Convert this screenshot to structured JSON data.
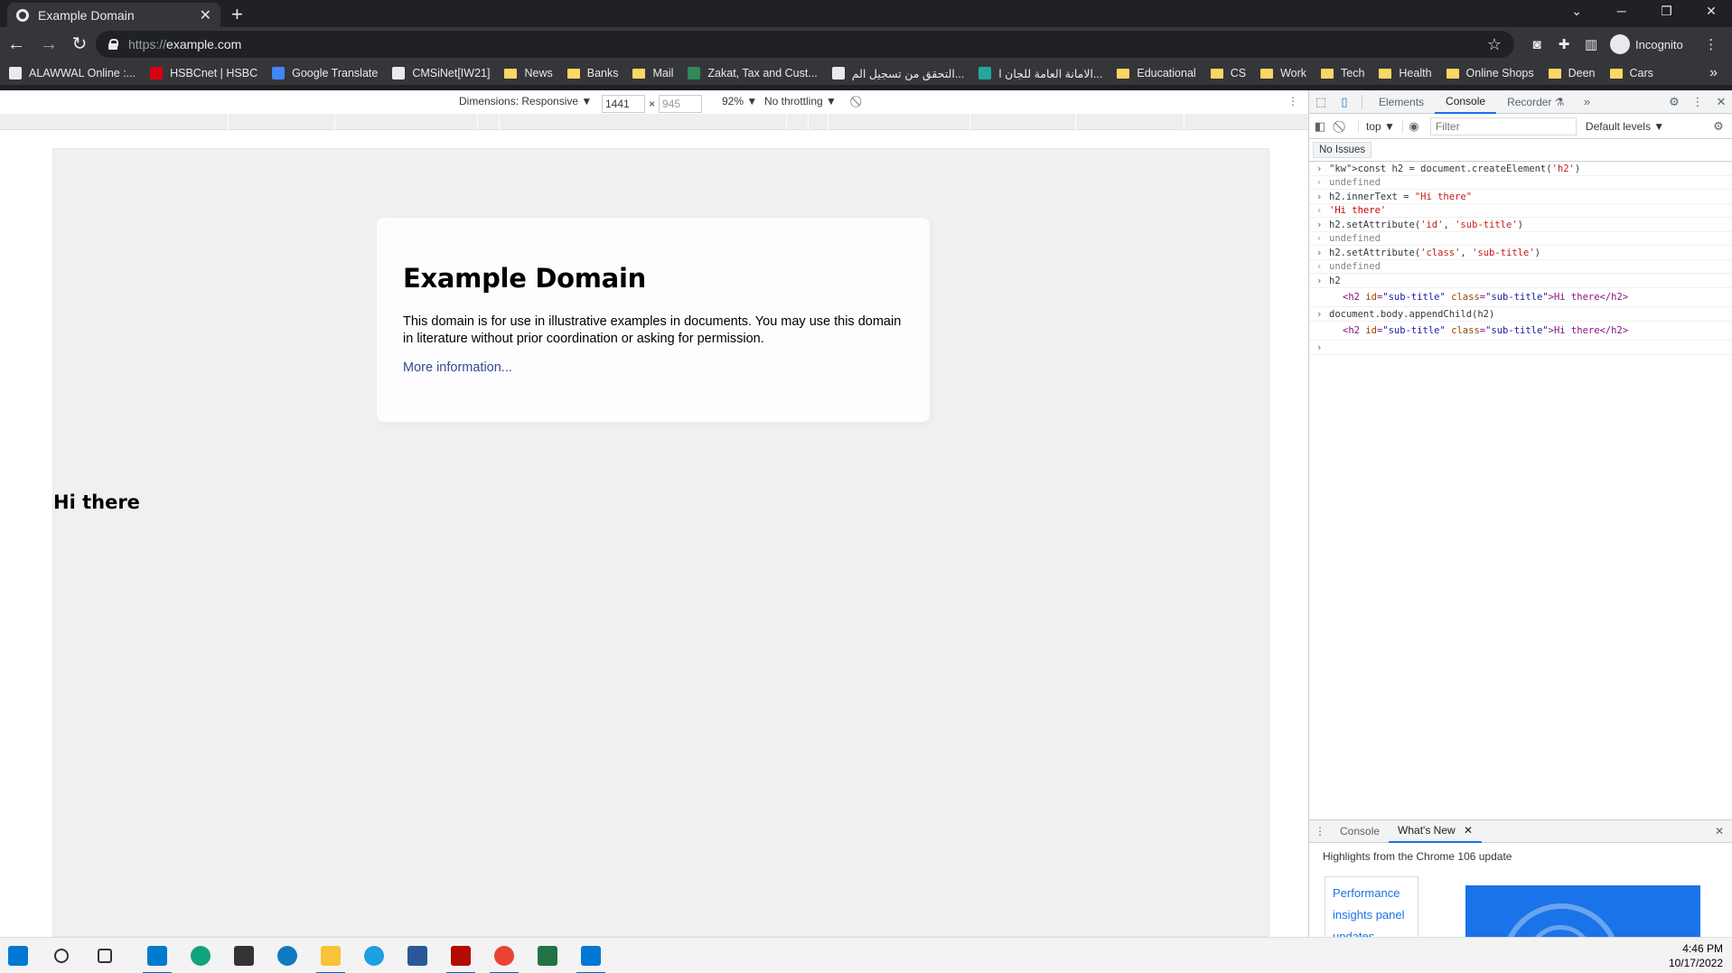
{
  "browser": {
    "tab_title": "Example Domain",
    "tab_close": "✕",
    "new_tab": "+",
    "url_scheme": "https://",
    "url_host": "example.com",
    "profile_label": "Incognito",
    "window_controls": {
      "minimize": "─",
      "restore": "❐",
      "close": "✕",
      "tab_search": "⌄"
    }
  },
  "bookmarks": [
    {
      "label": "ALAWWAL Online :...",
      "icon": "alawwal-icon",
      "color": "#e8eaed"
    },
    {
      "label": "HSBCnet | HSBC",
      "icon": "hsbc-icon",
      "color": "#db0011"
    },
    {
      "label": "Google Translate",
      "icon": "translate-icon",
      "color": "#4285f4"
    },
    {
      "label": "CMSiNet[IW21]",
      "icon": "cms-icon",
      "color": "#e8eaed"
    },
    {
      "label": "News",
      "icon": "folder-icon"
    },
    {
      "label": "Banks",
      "icon": "folder-icon"
    },
    {
      "label": "Mail",
      "icon": "folder-icon"
    },
    {
      "label": "Zakat, Tax and Cust...",
      "icon": "zakat-icon",
      "color": "#2e8b57"
    },
    {
      "label": "التحقق من تسجيل الم...",
      "icon": "page-icon",
      "color": "#e8eaed"
    },
    {
      "label": "الامانة العامة للجان ا...",
      "icon": "org-icon",
      "color": "#26a69a"
    },
    {
      "label": "Educational",
      "icon": "folder-icon"
    },
    {
      "label": "CS",
      "icon": "folder-icon"
    },
    {
      "label": "Work",
      "icon": "folder-icon"
    },
    {
      "label": "Tech",
      "icon": "folder-icon"
    },
    {
      "label": "Health",
      "icon": "folder-icon"
    },
    {
      "label": "Online Shops",
      "icon": "folder-icon"
    },
    {
      "label": "Deen",
      "icon": "folder-icon"
    },
    {
      "label": "Cars",
      "icon": "folder-icon"
    }
  ],
  "bookmarks_more": "»",
  "device_toolbar": {
    "dimensions_label": "Dimensions: Responsive ▼",
    "width": "1441",
    "height": "945",
    "times": "×",
    "zoom": "92% ▼",
    "throttling": "No throttling ▼"
  },
  "page": {
    "heading": "Example Domain",
    "paragraph": "This domain is for use in illustrative examples in documents. You may use this domain in literature without prior coordination or asking for permission.",
    "link": "More information...",
    "appended_h2": "Hi there"
  },
  "devtools": {
    "tabs": [
      "Elements",
      "Console",
      "Recorder ⚗"
    ],
    "active_tab": "Console",
    "more_tabs": "»",
    "context": "top ▼",
    "filter_placeholder": "Filter",
    "levels": "Default levels ▼",
    "issues": "No Issues",
    "console": [
      {
        "type": "in",
        "text": "const h2 = document.createElement('h2')"
      },
      {
        "type": "out",
        "text": "undefined"
      },
      {
        "type": "in",
        "text": "h2.innerText = \"Hi there\""
      },
      {
        "type": "str",
        "text": "'Hi there'"
      },
      {
        "type": "in",
        "text": "h2.setAttribute('id', 'sub-title')"
      },
      {
        "type": "out",
        "text": "undefined"
      },
      {
        "type": "in",
        "text": "h2.setAttribute('class', 'sub-title')"
      },
      {
        "type": "out",
        "text": "undefined"
      },
      {
        "type": "in",
        "text": "h2"
      },
      {
        "type": "el",
        "text": "<h2 id=\"sub-title\" class=\"sub-title\">Hi there</h2>"
      },
      {
        "type": "in",
        "text": "document.body.appendChild(h2)"
      },
      {
        "type": "el",
        "text": "<h2 id=\"sub-title\" class=\"sub-title\">Hi there</h2>"
      }
    ],
    "drawer": {
      "tabs": [
        "Console",
        "What's New"
      ],
      "active_tab": "What's New",
      "close_tab": "✕",
      "close_drawer": "✕",
      "highlights": "Highlights from the Chrome 106 update",
      "card_text": "Performance insights panel updates"
    }
  },
  "taskbar": {
    "apps": [
      {
        "name": "start-icon",
        "color": "#0078d4"
      },
      {
        "name": "search-icon",
        "color": "#333333"
      },
      {
        "name": "task-view-icon",
        "color": "#333333"
      },
      {
        "name": "vscode-icon",
        "color": "#007acc",
        "active": true
      },
      {
        "name": "chatgpt-icon",
        "color": "#10a37f"
      },
      {
        "name": "sticky-notes-icon",
        "color": "#333333"
      },
      {
        "name": "edge-icon",
        "color": "#0f7ac3"
      },
      {
        "name": "file-explorer-icon",
        "color": "#f8c33a",
        "active": true
      },
      {
        "name": "internet-explorer-icon",
        "color": "#1ea0e0"
      },
      {
        "name": "word-icon",
        "color": "#2b579a"
      },
      {
        "name": "pdf-reader-icon",
        "color": "#b30b00",
        "active": true
      },
      {
        "name": "chrome-icon",
        "color": "#ea4335",
        "active": true
      },
      {
        "name": "excel-icon",
        "color": "#217346"
      },
      {
        "name": "outlook-icon",
        "color": "#0078d4",
        "active": true
      }
    ],
    "time": "4:46 PM",
    "date": "10/17/2022"
  },
  "colors": {
    "link": "#38488f",
    "devtools_accent": "#1a73e8",
    "page_background": "#f0f0f2"
  }
}
